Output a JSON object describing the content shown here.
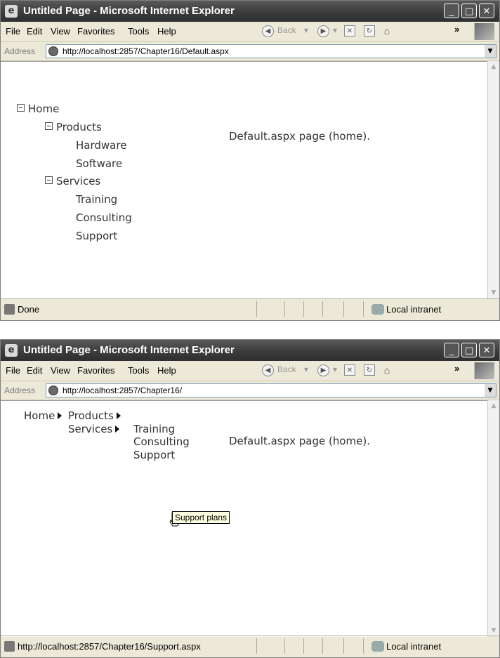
{
  "window1": {
    "title": "Untitled Page - Microsoft Internet Explorer",
    "menu": [
      "File",
      "Edit",
      "View",
      "Favorites",
      "Tools",
      "Help"
    ],
    "toolbar": {
      "back": "Back"
    },
    "address": {
      "label": "Address",
      "url": "http://localhost:2857/Chapter16/Default.aspx"
    },
    "tree": {
      "home": "Home",
      "products": "Products",
      "hardware": "Hardware",
      "software": "Software",
      "services": "Services",
      "training": "Training",
      "consulting": "Consulting",
      "support": "Support"
    },
    "page_text": "Default.aspx page (home).",
    "status": {
      "text": "Done",
      "zone": "Local intranet"
    }
  },
  "window2": {
    "title": "Untitled Page - Microsoft Internet Explorer",
    "menu": [
      "File",
      "Edit",
      "View",
      "Favorites",
      "Tools",
      "Help"
    ],
    "toolbar": {
      "back": "Back"
    },
    "address": {
      "label": "Address",
      "url": "http://localhost:2857/Chapter16/"
    },
    "menu_control": {
      "home": "Home",
      "products": "Products",
      "services": "Services",
      "training": "Training",
      "consulting": "Consulting",
      "support": "Support"
    },
    "tooltip": "Support plans",
    "page_text": "Default.aspx page (home).",
    "status": {
      "text": "http://localhost:2857/Chapter16/Support.aspx",
      "zone": "Local intranet"
    }
  },
  "icons": [
    "ie-logo-icon",
    "minimize-icon",
    "maximize-icon",
    "close-icon",
    "back-icon",
    "forward-icon",
    "stop-icon",
    "refresh-icon",
    "home-icon",
    "windows-flag-icon",
    "page-icon",
    "dropdown-icon",
    "globe-icon",
    "intranet-icon",
    "hand-cursor-icon"
  ]
}
